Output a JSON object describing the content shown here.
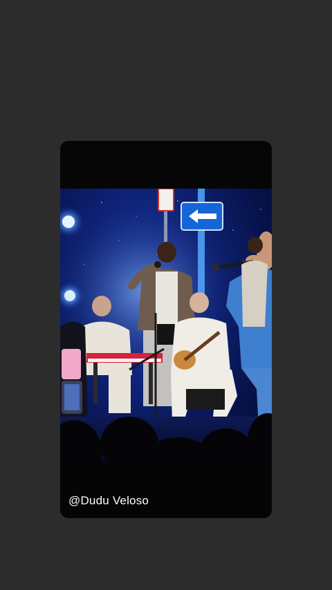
{
  "story": {
    "watermark": "@Dudu Veloso"
  },
  "colors": {
    "page_background": "#2c2c2c",
    "stage_blue": "#1d3da8",
    "sign_blue": "#1565d8",
    "keyboard_red": "#d8213a"
  },
  "icons": {
    "street_sign": "left-arrow-icon"
  }
}
